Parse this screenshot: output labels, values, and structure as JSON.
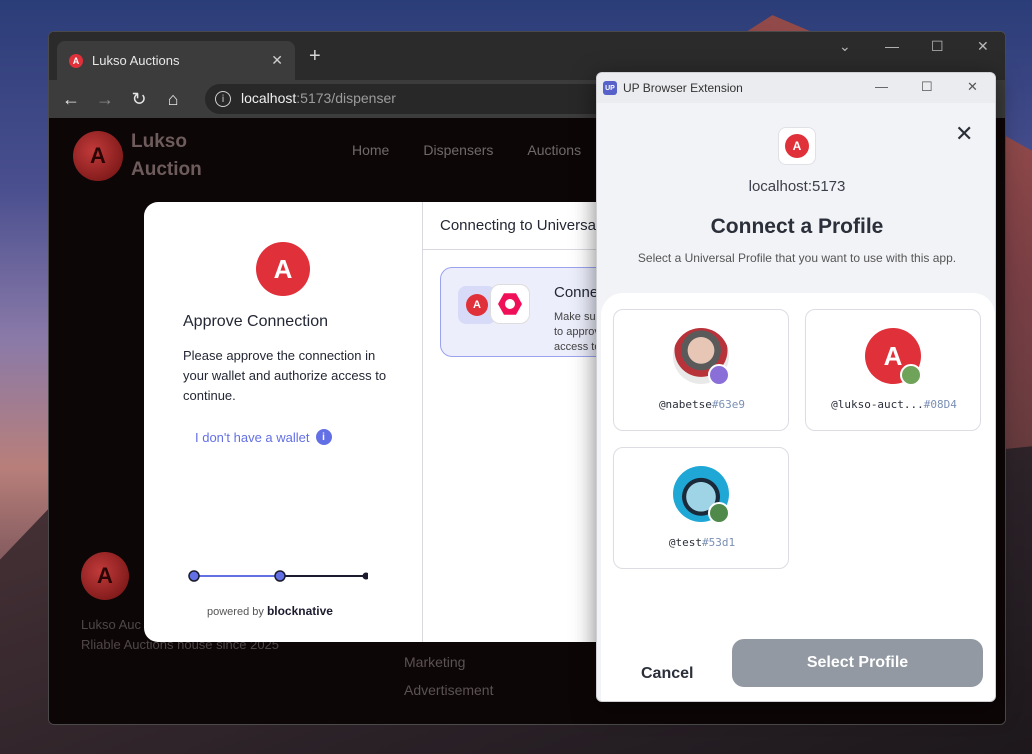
{
  "browser": {
    "tab_title": "Lukso Auctions",
    "url_host": "localhost",
    "url_path": ":5173/dispenser",
    "icons": [
      "back-icon",
      "forward-icon",
      "reload-icon",
      "home-icon",
      "site-info-icon"
    ]
  },
  "site": {
    "brand_line1": "Lukso",
    "brand_line2": "Auction",
    "nav": [
      "Home",
      "Dispensers",
      "Auctions"
    ],
    "footer_line1": "Lukso Auc",
    "footer_line2": "Rliable Auctions house since 2025",
    "footer_links": [
      "Marketing",
      "Advertisement"
    ]
  },
  "modal": {
    "approve_title": "Approve Connection",
    "approve_text": "Please approve the connection in your wallet and authorize access to continue.",
    "no_wallet": "I don't have a wallet",
    "powered_by": "powered by",
    "powered_brand": "blocknative",
    "connecting_header": "Connecting to Universal Profile",
    "card_title": "Connecting",
    "card_text": "Make sure to approve access to"
  },
  "extension": {
    "window_title": "UP Browser Extension",
    "host": "localhost:5173",
    "heading": "Connect a Profile",
    "subheading": "Select a Universal Profile that you want to use with this app.",
    "profiles": [
      {
        "name": "@nabetse",
        "hash": "#63e9"
      },
      {
        "name": "@lukso-auct...",
        "hash": "#08D4"
      },
      {
        "name": "@test",
        "hash": "#53d1"
      }
    ],
    "cancel_label": "Cancel",
    "select_label": "Select Profile"
  },
  "colors": {
    "accent": "#6370e5",
    "brand_red": "#e0303a",
    "select_button": "#9299a3"
  }
}
